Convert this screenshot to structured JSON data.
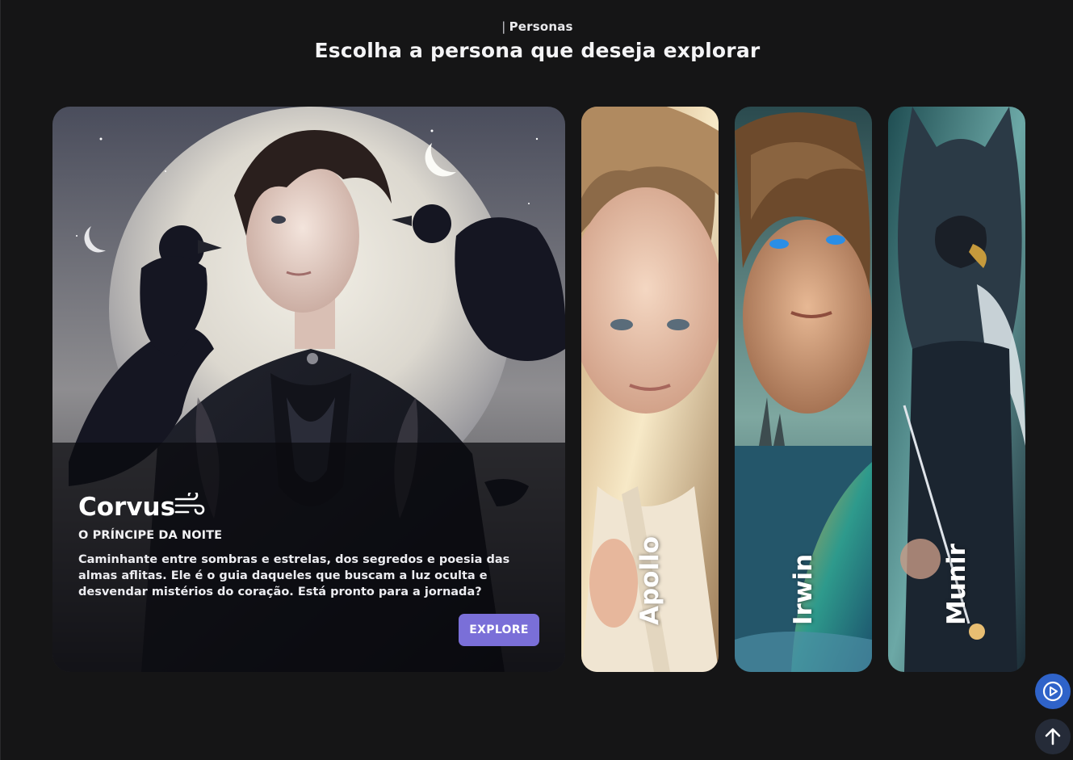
{
  "header": {
    "eyebrow": "Personas",
    "title": "Escolha a persona que deseja explorar"
  },
  "featured": {
    "name": "Corvus",
    "icon": "wind-icon",
    "subtitle": "O PRÍNCIPE DA NOITE",
    "description": "Caminhante entre sombras e estrelas, dos segredos e poesia das almas aflitas. Ele é o guia daqueles que buscam a luz oculta e desvendar mistérios do coração. Está pronto para a jornada?",
    "button_label": "EXPLORE"
  },
  "personas": [
    {
      "name": "Apollo"
    },
    {
      "name": "Irwin"
    },
    {
      "name": "Munir"
    }
  ],
  "floating": {
    "play_icon": "play-circle-icon",
    "top_icon": "arrow-up-icon"
  },
  "colors": {
    "background": "#151516",
    "accent": "#7a6fd8",
    "play_button": "#2f63c9"
  }
}
